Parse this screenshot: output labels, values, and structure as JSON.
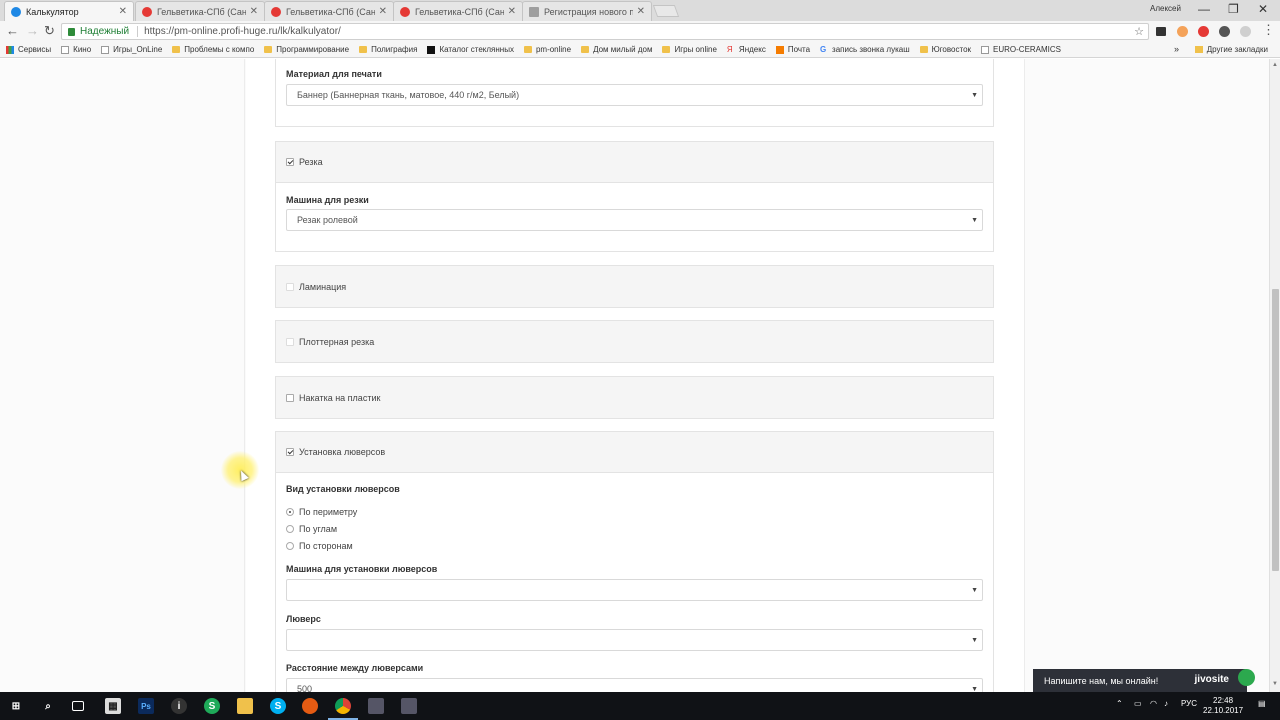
{
  "browser": {
    "tabs": [
      {
        "label": "Калькулятор",
        "active": true,
        "color": "#1e88e5"
      },
      {
        "label": "Гельветика-СПб (Санкт",
        "active": false,
        "color": "#e53935"
      },
      {
        "label": "Гельветика-СПб (Санкт",
        "active": false,
        "color": "#e53935"
      },
      {
        "label": "Гельветика-СПб (Санкт",
        "active": false,
        "color": "#e53935"
      },
      {
        "label": "Регистрация нового по",
        "active": false,
        "color": "#9e9e9e"
      }
    ],
    "tab_close": "✕",
    "profile_name": "Алексей",
    "window_controls": {
      "minimize": "—",
      "restore": "❐",
      "close": "✕"
    },
    "nav": {
      "back": "←",
      "forward": "→",
      "reload": "↻"
    },
    "secure_label": "Надежный",
    "url": "https://pm-online.profi-huge.ru/lk/kalkulyator/",
    "bookmark_star": "☆",
    "bookmarks": [
      {
        "label": "Сервисы",
        "icon": "apps-icon"
      },
      {
        "label": "Кино",
        "icon": "page-icon"
      },
      {
        "label": "Игры_OnLine",
        "icon": "page-icon"
      },
      {
        "label": "Проблемы с компо",
        "icon": "folder-icon"
      },
      {
        "label": "Программирование",
        "icon": "folder-icon"
      },
      {
        "label": "Полиграфия",
        "icon": "folder-icon"
      },
      {
        "label": "Каталог стеклянных",
        "icon": "page-icon"
      },
      {
        "label": "pm-online",
        "icon": "folder-icon"
      },
      {
        "label": "Дом милый дом",
        "icon": "folder-icon"
      },
      {
        "label": "Игры online",
        "icon": "folder-icon"
      },
      {
        "label": "Яндекс",
        "icon": "yandex-icon"
      },
      {
        "label": "Почта",
        "icon": "mail-icon"
      },
      {
        "label": "запись звонка лукаш",
        "icon": "google-icon"
      },
      {
        "label": "Юговосток",
        "icon": "folder-icon"
      },
      {
        "label": "EURO-CERAMICS",
        "icon": "page-icon"
      }
    ],
    "bookmarks_more": "»",
    "other_bookmarks": "Другие закладки"
  },
  "form": {
    "material": {
      "label": "Материал для печати",
      "value": "Баннер (Баннерная ткань, матовое, 440 г/м2, Белый)"
    },
    "cutting": {
      "label": "Резка",
      "checked": true
    },
    "cutting_machine": {
      "label": "Машина для резки",
      "value": "Резак ролевой"
    },
    "lamination": {
      "label": "Ламинация",
      "checked": false
    },
    "plotter": {
      "label": "Плоттерная резка",
      "checked": false
    },
    "plastic": {
      "label": "Накатка на пластик",
      "checked": false
    },
    "grommets": {
      "label": "Установка люверсов",
      "checked": true
    },
    "grommet_type": {
      "label": "Вид установки люверсов",
      "options": [
        {
          "label": "По периметру",
          "selected": true
        },
        {
          "label": "По углам",
          "selected": false
        },
        {
          "label": "По сторонам",
          "selected": false
        }
      ]
    },
    "grommet_machine": {
      "label": "Машина для установки люверсов",
      "value": ""
    },
    "grommet": {
      "label": "Люверс",
      "value": ""
    },
    "grommet_distance": {
      "label": "Расстояние между люверсами",
      "value": "500"
    },
    "caret": "▼"
  },
  "chat": {
    "text": "Напишите нам, мы онлайн!",
    "brand": "jivosite"
  },
  "taskbar": {
    "tray_lang": "РУС",
    "time": "22:48",
    "date": "22.10.2017"
  }
}
